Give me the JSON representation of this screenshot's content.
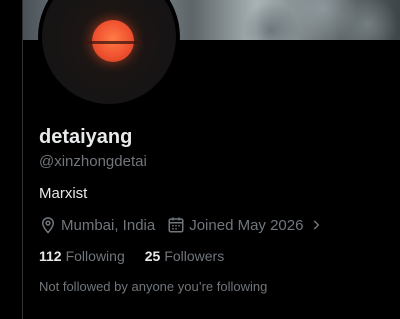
{
  "profile": {
    "display_name": "detaiyang",
    "handle": "@xinzhongdetai",
    "bio": "Marxist",
    "location": "Mumbai, India",
    "joined": "Joined May 2026",
    "following_count": "112",
    "following_label": "Following",
    "followers_count": "25",
    "followers_label": "Followers",
    "followed_by_note": "Not followed by anyone you’re following"
  },
  "icons": {
    "location": "location-pin-icon",
    "calendar": "calendar-icon",
    "chevron": "chevron-right-icon"
  },
  "colors": {
    "background": "#000000",
    "primary_text": "#e7e9ea",
    "secondary_text": "#71767b",
    "avatar_accent": "#f05330"
  }
}
